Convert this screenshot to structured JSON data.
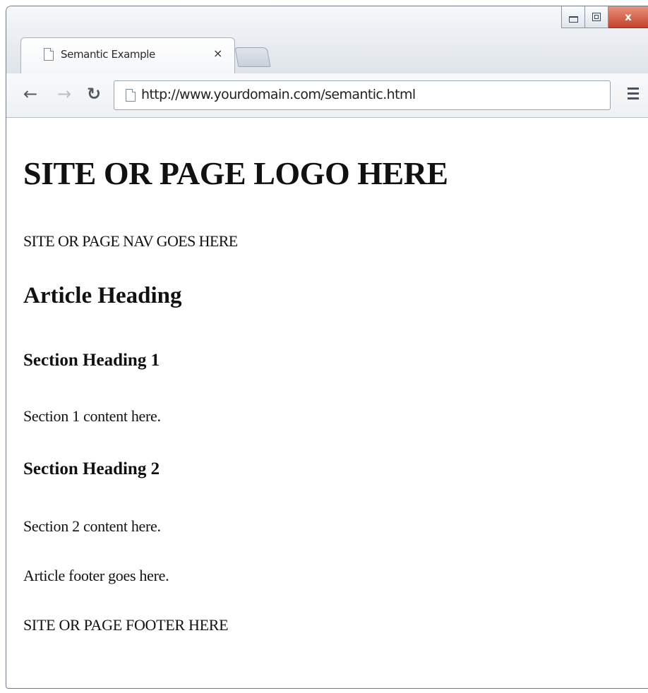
{
  "browser": {
    "tab_title": "Semantic Example",
    "tab_close": "×",
    "url": "http://www.yourdomain.com/semantic.html",
    "window_close": "x"
  },
  "page": {
    "logo": "SITE OR PAGE LOGO HERE",
    "nav": "SITE OR PAGE NAV GOES HERE",
    "article_heading": "Article Heading",
    "section1_heading": "Section Heading 1",
    "section1_content": "Section 1 content here.",
    "section2_heading": "Section Heading 2",
    "section2_content": "Section 2 content here.",
    "article_footer": "Article footer goes here.",
    "site_footer": "SITE OR PAGE FOOTER HERE"
  }
}
